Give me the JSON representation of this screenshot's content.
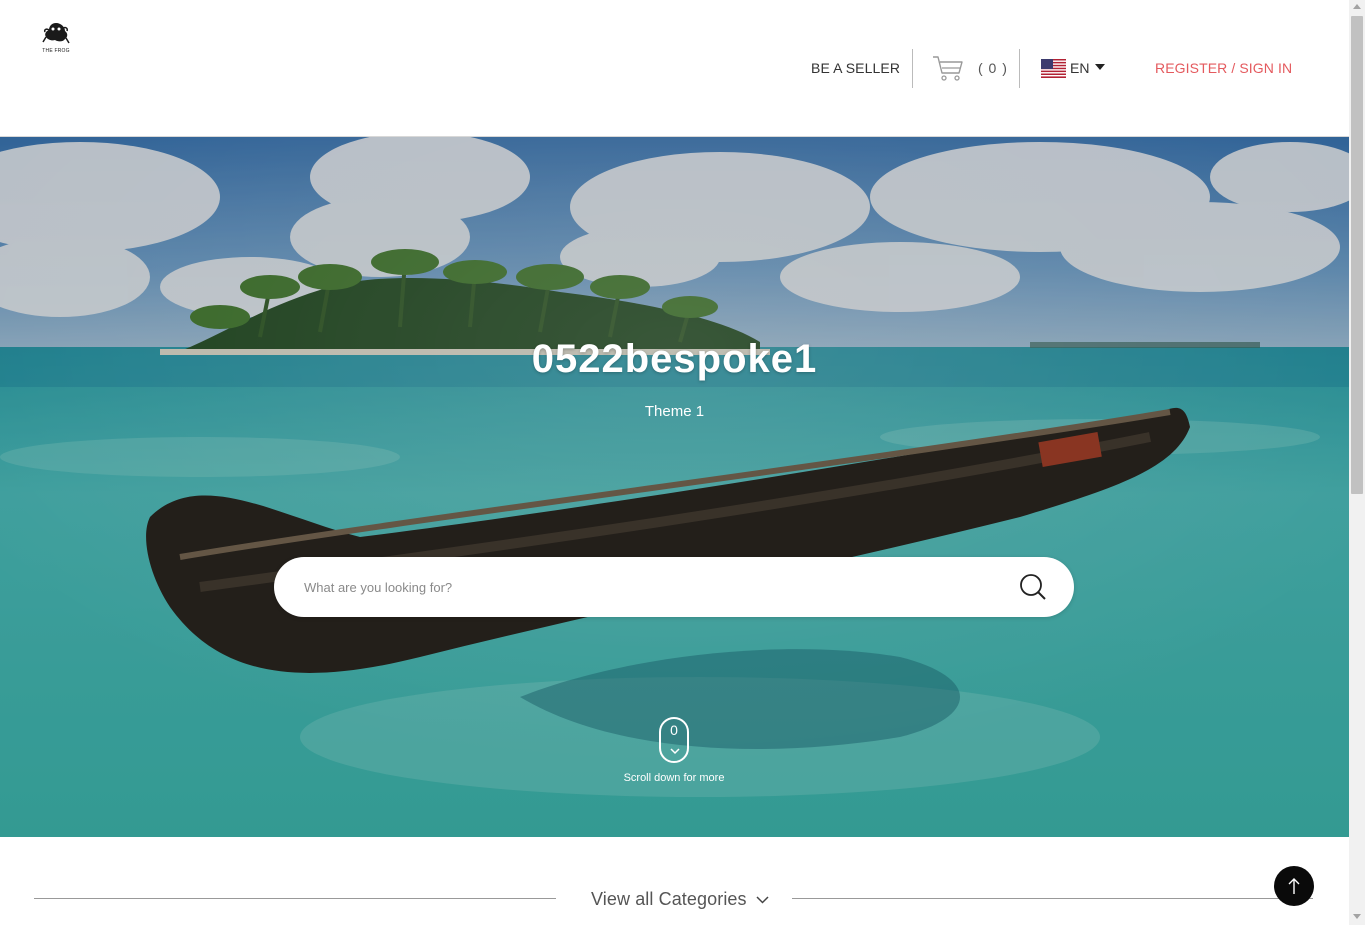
{
  "header": {
    "logo_text": "THE FROG",
    "be_seller": "BE A SELLER",
    "cart_count": "( 0 )",
    "language": "EN",
    "register": "REGISTER / SIGN IN"
  },
  "hero": {
    "title": "0522bespoke1",
    "subtitle": "Theme 1",
    "search_placeholder": "What are you looking for?",
    "scroll_digit": "0",
    "scroll_text": "Scroll down for more"
  },
  "categories": {
    "label": "View all Categories"
  },
  "icons": {
    "logo": "frog-logo-icon",
    "cart": "shopping-cart-icon",
    "flag": "uk-flag-icon",
    "search": "search-icon",
    "mouse": "mouse-scroll-icon",
    "back_to_top": "arrow-up-icon"
  },
  "colors": {
    "accent": "#e45a5e",
    "top_button": "#0a0a0a"
  }
}
